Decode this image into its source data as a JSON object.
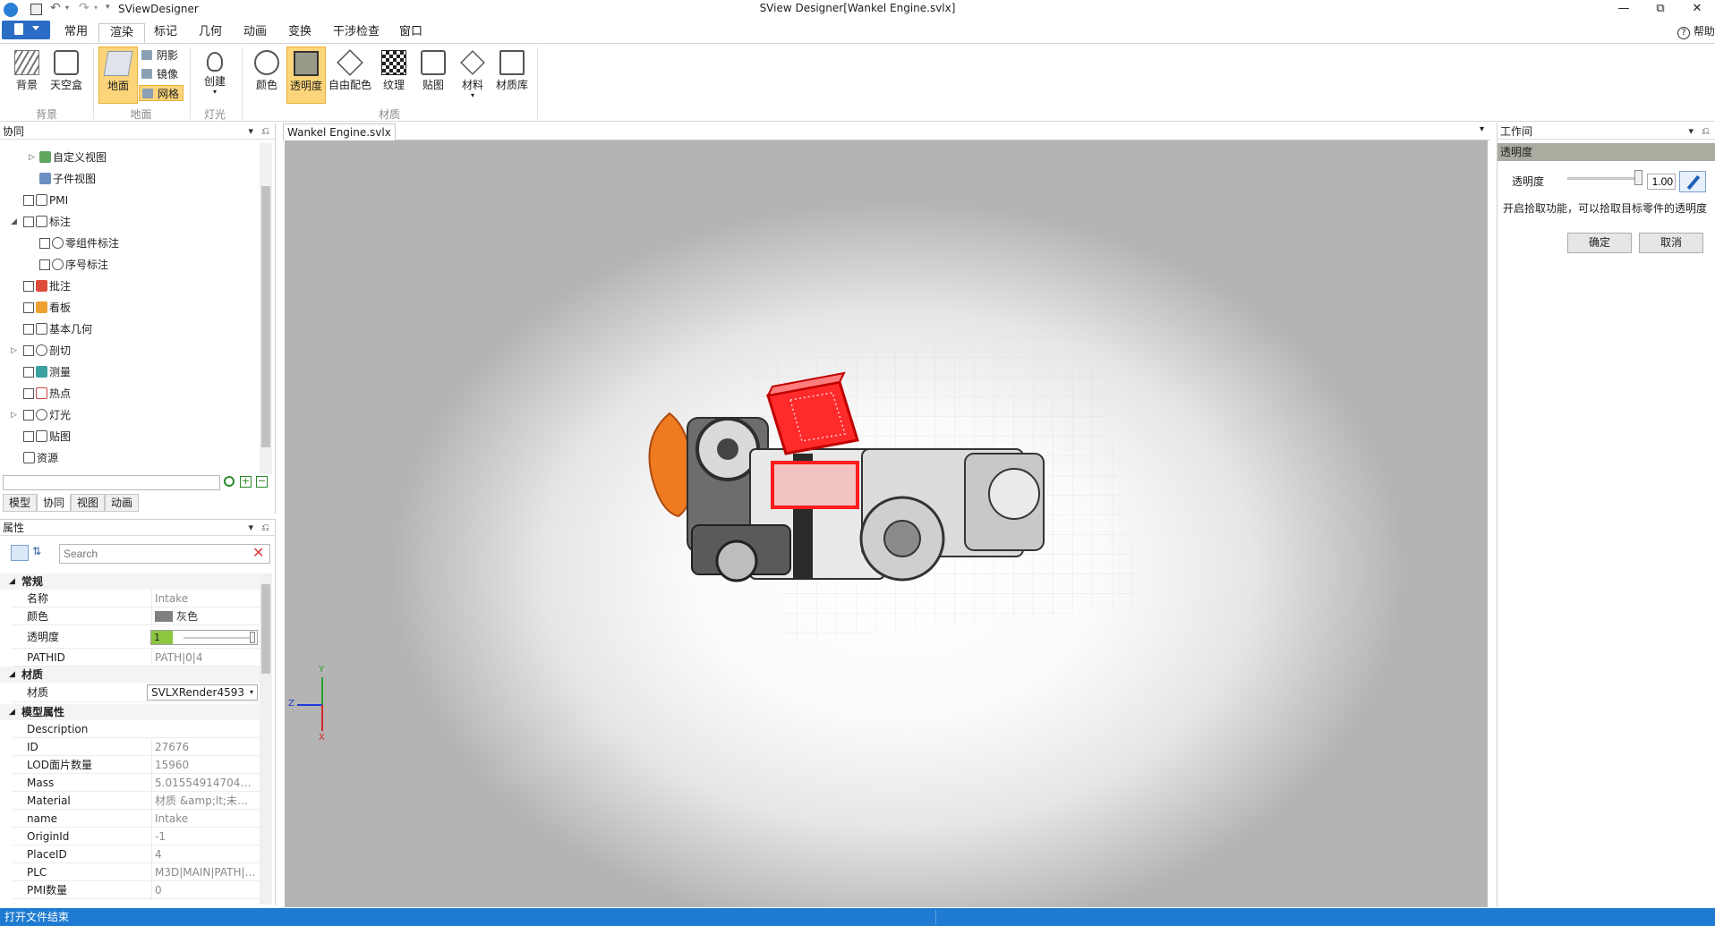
{
  "app": {
    "name": "SViewDesigner",
    "window_title": "SView Designer[Wankel Engine.svlx]",
    "help_label": "帮助"
  },
  "menu": {
    "tabs": [
      {
        "label": "常用"
      },
      {
        "label": "渲染"
      },
      {
        "label": "标记"
      },
      {
        "label": "几何"
      },
      {
        "label": "动画"
      },
      {
        "label": "变换"
      },
      {
        "label": "干涉检查"
      },
      {
        "label": "窗口"
      }
    ],
    "active_tab": "渲染"
  },
  "ribbon": {
    "background_label": "背景",
    "skybox_label": "天空盒",
    "ground_label": "地面",
    "shadow_label": "阴影",
    "mirror_label": "镜像",
    "grid_label": "网格",
    "create_label": "创建",
    "color_label": "颜色",
    "transparency_label": "透明度",
    "free_color_label": "自由配色",
    "texture_label": "纹理",
    "decal_label": "贴图",
    "material_label": "材料",
    "material_lib_label": "材质库",
    "groups": {
      "background": "背景",
      "ground": "地面",
      "light": "灯光",
      "material": "材质"
    }
  },
  "collab_panel": {
    "title": "协同",
    "items": [
      {
        "label": "自定义视图"
      },
      {
        "label": "子件视图"
      },
      {
        "label": "PMI"
      },
      {
        "label": "标注"
      },
      {
        "label": "零组件标注"
      },
      {
        "label": "序号标注"
      },
      {
        "label": "批注"
      },
      {
        "label": "看板"
      },
      {
        "label": "基本几何"
      },
      {
        "label": "剖切"
      },
      {
        "label": "测量"
      },
      {
        "label": "热点"
      },
      {
        "label": "灯光"
      },
      {
        "label": "贴图"
      },
      {
        "label": "资源"
      }
    ],
    "search_value": "",
    "tabs": [
      {
        "label": "模型"
      },
      {
        "label": "协同"
      },
      {
        "label": "视图"
      },
      {
        "label": "动画"
      }
    ]
  },
  "properties_panel": {
    "title": "属性",
    "search_placeholder": "Search",
    "categories": {
      "general": "常规",
      "material": "材质",
      "model_props": "模型属性"
    },
    "general_rows": [
      {
        "key": "名称",
        "value": "Intake"
      },
      {
        "key": "颜色",
        "value": "灰色"
      },
      {
        "key": "透明度",
        "value": "1"
      },
      {
        "key": "PATHID",
        "value": "PATH|0|4"
      }
    ],
    "material_row": {
      "key": "材质",
      "value": "SVLXRender4593"
    },
    "model_rows": [
      {
        "key": "Description",
        "value": ""
      },
      {
        "key": "ID",
        "value": "27676"
      },
      {
        "key": "LOD面片数量",
        "value": "15960"
      },
      {
        "key": "Mass",
        "value": "5.01554914704531..."
      },
      {
        "key": "Material",
        "value": "材质 &amp;lt;未指..."
      },
      {
        "key": "name",
        "value": "Intake"
      },
      {
        "key": "OriginId",
        "value": "-1"
      },
      {
        "key": "PlaceID",
        "value": "4"
      },
      {
        "key": "PLC",
        "value": "M3D|MAIN|PATH|0..."
      },
      {
        "key": "PMI数量",
        "value": "0"
      }
    ],
    "transparency_fill": 0.2
  },
  "document": {
    "tab_label": "Wankel Engine.svlx"
  },
  "axis": {
    "y": "Y",
    "z": "Z",
    "x": "X"
  },
  "workspace": {
    "title": "工作间",
    "section": "透明度",
    "slider_label": "透明度",
    "slider_value": "1.00",
    "slider_fraction": 1.0,
    "hint": "开启拾取功能，可以拾取目标零件的透明度",
    "ok_label": "确定",
    "cancel_label": "取消"
  },
  "status": {
    "text": "打开文件结束"
  },
  "colors": {
    "accent_blue": "#1e7bd1",
    "ribbon_selected": "#fcd57b",
    "highlight_red": "#ff1c1c"
  }
}
